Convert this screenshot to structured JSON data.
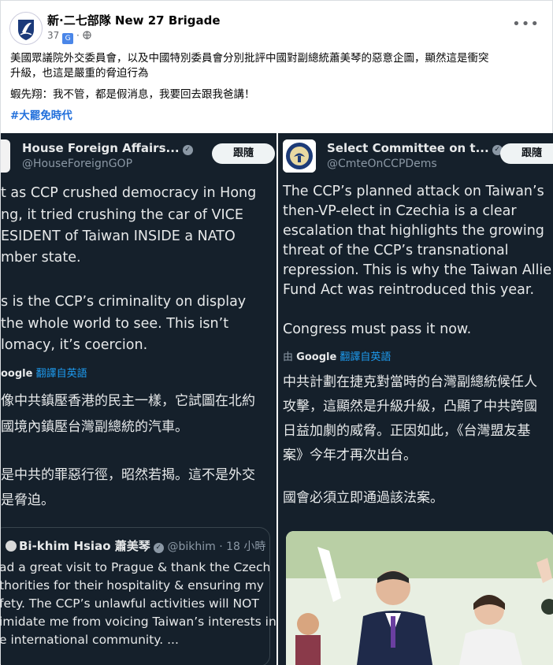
{
  "post": {
    "page_name": "新·二七部隊 New 27 Brigade",
    "meta_prefix": "37",
    "meta_suffix": "·",
    "line1": "美國眾議院外交委員會，以及中國特別委員會分別批評中國對副總統蕭美琴的惡意企圖，顯然這是衝突",
    "line2": "升級，也這是嚴重的脅迫行為",
    "line3": "蝦先翔：我不管，都是假消息，我要回去跟我爸講！",
    "hashtag": "#大罷免時代",
    "more_label": "•••"
  },
  "tweet_left": {
    "name": "House Foreign Affairs...",
    "handle": "@HouseForeignGOP",
    "follow": "跟隨",
    "en_lines": [
      "t as CCP crushed democracy in Hong",
      "ng, it tried crushing the car of VICE",
      "ESIDENT of Taiwan INSIDE a NATO",
      "mber state.",
      "s is the CCP’s criminality on display",
      " the whole world to see. This isn’t",
      "lomacy, it’s coercion."
    ],
    "google_by": "oogle",
    "translate_link": "翻譯自英語",
    "zh_lines": [
      "像中共鎮壓香港的民主一樣，它試圖在北約",
      "國境內鎮壓台灣副總統的汽車。",
      "是中共的罪惡行徑，昭然若揭。這不是外交",
      "是脅迫。"
    ],
    "quote_name": "Bi-khim Hsiao 蕭美琴",
    "quote_handle": "@bikhim · 18 小時",
    "quote_lines": [
      "ad a great visit to Prague & thank the Czech",
      "thorities for their hospitality & ensuring my",
      "fety. The CCP’s unlawful activities will NOT",
      "imidate me from voicing Taiwan’s interests in",
      "e international community. ..."
    ]
  },
  "tweet_right": {
    "name": "Select Committee on t...",
    "handle": "@CmteOnCCPDems",
    "follow": "跟隨",
    "en_lines": [
      "The CCP’s planned attack on Taiwan’s",
      "then-VP-elect in Czechia is a clear",
      "escalation that highlights the growing",
      "threat of the CCP’s transnational",
      "repression. This is why the Taiwan Allie",
      "Fund Act was reintroduced this year.",
      "Congress must pass it now."
    ],
    "google_prefix": "由",
    "google_word": "Google",
    "translate_link": "翻譯自英語",
    "zh_lines": [
      "中共計劃在捷克對當時的台灣副總統候任人",
      "攻擊，這顯然是升級升級，凸顯了中共跨國",
      "日益加劇的威脅。正因如此，《台灣盟友基",
      "案》今年才再次出台。",
      "國會必須立即通過該法案。"
    ]
  }
}
